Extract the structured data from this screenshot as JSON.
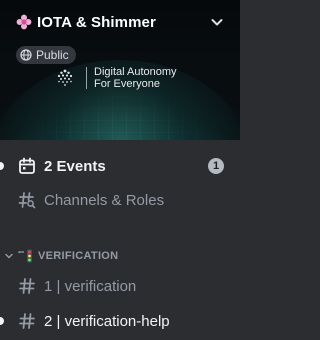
{
  "server": {
    "name": "IOTA & Shimmer",
    "visibility": "Public",
    "banner": {
      "tagline_line1": "Digital Autonomy",
      "tagline_line2": "For Everyone"
    }
  },
  "channels": {
    "events": {
      "label": "2 Events",
      "count": "1",
      "icon": "calendar-icon"
    },
    "channels_roles": {
      "label": "Channels & Roles",
      "icon": "channels-roles-icon"
    },
    "category": {
      "name": "VERIFICATION",
      "icon": "traffic-light-emoji",
      "collapsed_icon": "chevron-down-icon"
    },
    "items": [
      {
        "label": "1 | verification",
        "icon": "hash-icon",
        "unread": false
      },
      {
        "label": "2 | verification-help",
        "icon": "hash-icon",
        "unread": true
      }
    ]
  },
  "colors": {
    "background": "#2b2d31",
    "text_active": "#f2f3f5",
    "text_muted": "#949ba4",
    "badge": "#b5bac1"
  }
}
